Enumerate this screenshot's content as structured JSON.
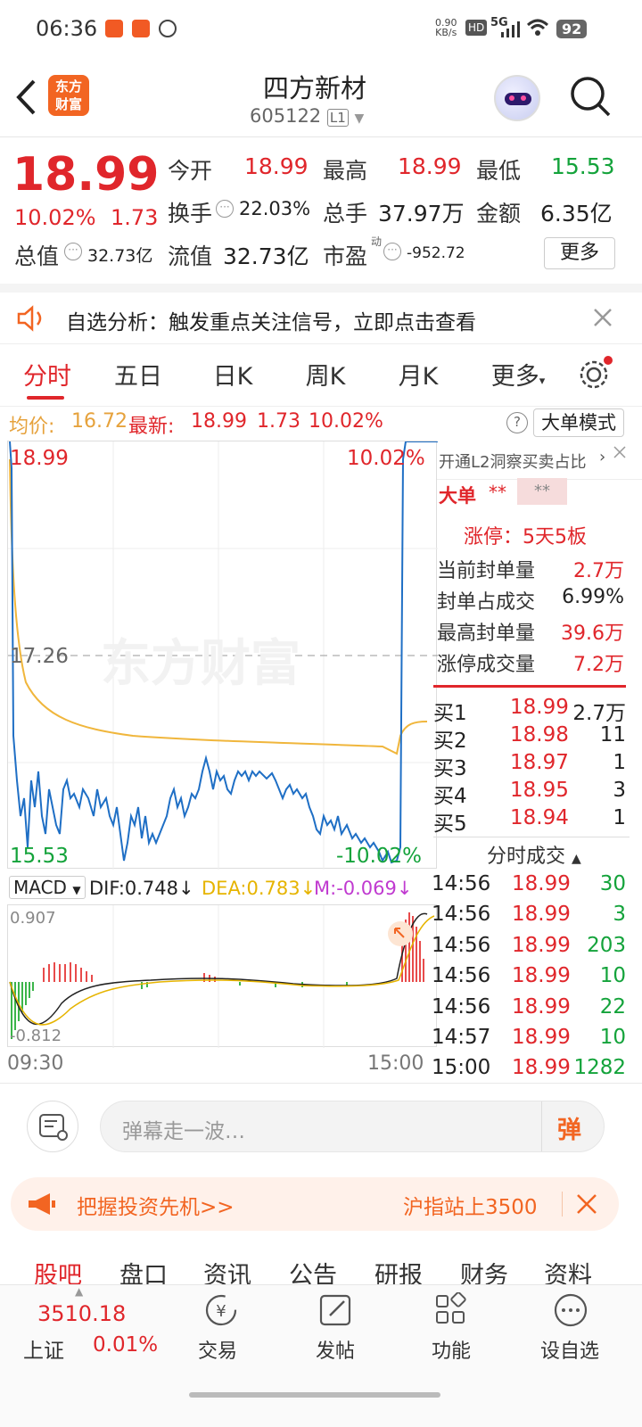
{
  "status": {
    "time": "06:36",
    "net_speed_top": "0.90",
    "net_speed_unit": "KB/s",
    "hd": "HD",
    "signal": "5G",
    "battery": "92"
  },
  "header": {
    "logo_line1": "东方",
    "logo_line2": "财富",
    "title": "四方新材",
    "code": "605122",
    "level": "L1"
  },
  "quote": {
    "price": "18.99",
    "change_pct": "10.02%",
    "change": "1.73",
    "open_label": "今开",
    "open": "18.99",
    "high_label": "最高",
    "high": "18.99",
    "low_label": "最低",
    "low": "15.53",
    "turnover_label": "换手",
    "turnover": "22.03%",
    "volume_label": "总手",
    "volume": "37.97万",
    "amount_label": "金额",
    "amount": "6.35亿",
    "mcap_label": "总值",
    "mcap": "32.73亿",
    "float_label": "流值",
    "float": "32.73亿",
    "pe_label": "市盈",
    "pe_sup": "动",
    "pe": "-952.72",
    "more": "更多"
  },
  "notice": {
    "text": "自选分析：触发重点关注信号，立即点击查看"
  },
  "tabs": [
    "分时",
    "五日",
    "日K",
    "周K",
    "月K",
    "更多"
  ],
  "info": {
    "avg_label": "均价:",
    "avg": "16.72",
    "latest_label": "最新:",
    "latest": "18.99",
    "chg": "1.73",
    "pct": "10.02%",
    "mode": "大单模式"
  },
  "chart": {
    "top_price": "18.99",
    "top_pct": "10.02%",
    "mid_price": "17.26",
    "bottom_price": "15.53",
    "bottom_pct": "-10.02%",
    "watermark": "东方财富"
  },
  "macd": {
    "name": "MACD",
    "dif": "DIF:0.748",
    "dea": "DEA:0.783",
    "m": "M:-0.069",
    "top": "0.907",
    "bottom": "-0.812",
    "t_start": "09:30",
    "t_end": "15:00"
  },
  "side": {
    "promo": "开通L2洞察买卖占比",
    "big_label": "大单",
    "big_v1": "**",
    "big_v2": "**",
    "limit_title": "涨停：5天5板",
    "stats": [
      {
        "label": "当前封单量",
        "value": "2.7万",
        "cls": "red"
      },
      {
        "label": "封单占成交",
        "value": "6.99%",
        "cls": ""
      },
      {
        "label": "最高封单量",
        "value": "39.6万",
        "cls": "red"
      },
      {
        "label": "涨停成交量",
        "value": "7.2万",
        "cls": "red"
      }
    ],
    "bids": [
      {
        "label": "买1",
        "price": "18.99",
        "vol": "2.7万"
      },
      {
        "label": "买2",
        "price": "18.98",
        "vol": "11"
      },
      {
        "label": "买3",
        "price": "18.97",
        "vol": "1"
      },
      {
        "label": "买4",
        "price": "18.95",
        "vol": "3"
      },
      {
        "label": "买5",
        "price": "18.94",
        "vol": "1"
      }
    ],
    "trades_title": "分时成交",
    "trades": [
      {
        "t": "14:56",
        "p": "18.99",
        "v": "30",
        "cls": "green"
      },
      {
        "t": "14:56",
        "p": "18.99",
        "v": "3",
        "cls": "green"
      },
      {
        "t": "14:56",
        "p": "18.99",
        "v": "203",
        "cls": "green"
      },
      {
        "t": "14:56",
        "p": "18.99",
        "v": "10",
        "cls": "green"
      },
      {
        "t": "14:56",
        "p": "18.99",
        "v": "22",
        "cls": "green"
      },
      {
        "t": "14:57",
        "p": "18.99",
        "v": "10",
        "cls": "green"
      },
      {
        "t": "15:00",
        "p": "18.99",
        "v": "1282",
        "cls": "green"
      }
    ]
  },
  "danmu": {
    "placeholder": "弹幕走一波…",
    "btn": "弹"
  },
  "banner": {
    "left": "把握投资先机>>",
    "right": "沪指站上3500"
  },
  "bottom_tabs": [
    "股吧",
    "盘口",
    "资讯",
    "公告",
    "研报",
    "财务",
    "资料"
  ],
  "footer": {
    "index_value": "3510.18",
    "index_name": "上证",
    "index_pct": "0.01%",
    "items": [
      "交易",
      "发帖",
      "功能",
      "设自选"
    ]
  }
}
